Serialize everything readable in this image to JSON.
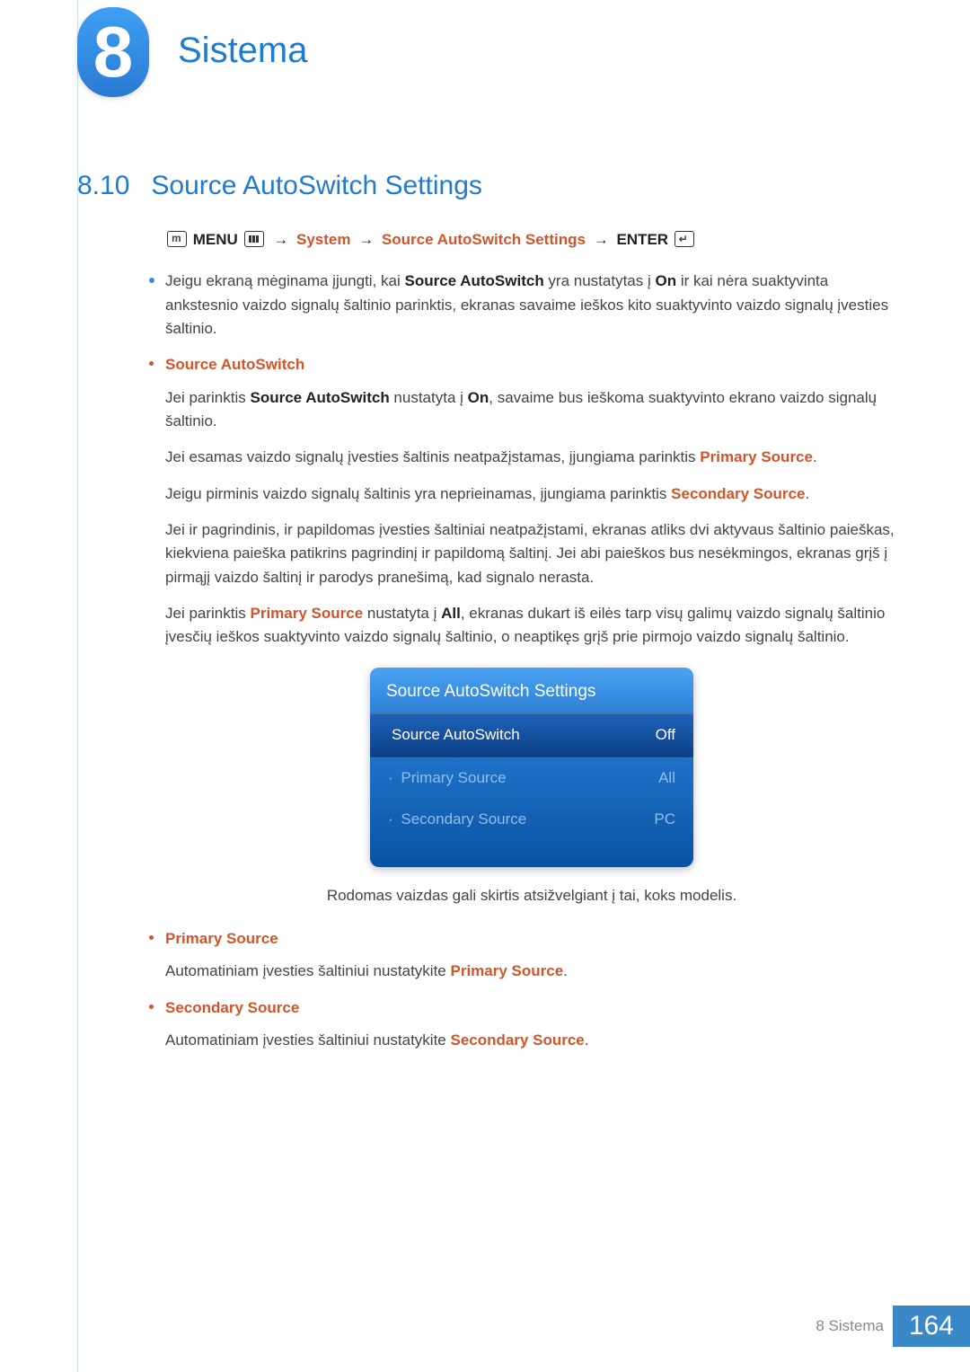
{
  "chapter": {
    "number": "8",
    "title": "Sistema"
  },
  "section": {
    "number": "8.10",
    "title": "Source AutoSwitch Settings"
  },
  "nav": {
    "menu": "MENU",
    "system": "System",
    "sas": "Source AutoSwitch Settings",
    "enter": "ENTER"
  },
  "intro": {
    "t1a": "Jeigu ekraną mėginama įjungti, kai ",
    "t1b": "Source AutoSwitch",
    "t1c": " yra nustatytas į ",
    "t1d": "On",
    "t1e": " ir kai nėra suaktyvinta ankstesnio vaizdo signalų šaltinio parinktis, ekranas savaime ieškos kito suaktyvinto vaizdo signalų įvesties šaltinio."
  },
  "sa": {
    "heading": "Source AutoSwitch",
    "p1a": "Jei parinktis ",
    "p1b": "Source AutoSwitch",
    "p1c": " nustatyta į ",
    "p1d": "On",
    "p1e": ", savaime bus ieškoma suaktyvinto ekrano vaizdo signalų šaltinio.",
    "p2a": "Jei esamas vaizdo signalų įvesties šaltinis neatpažįstamas, įjungiama parinktis ",
    "p2b": "Primary Source",
    "p2c": ".",
    "p3a": "Jeigu pirminis vaizdo signalų šaltinis yra neprieinamas, įjungiama parinktis ",
    "p3b": "Secondary Source",
    "p3c": ".",
    "p4": "Jei ir pagrindinis, ir papildomas įvesties šaltiniai neatpažįstami, ekranas atliks dvi aktyvaus šaltinio paieškas, kiekviena paieška patikrins pagrindinį ir papildomą šaltinį. Jei abi paieškos bus nesėkmingos, ekranas grįš į pirmąjį vaizdo šaltinį ir parodys pranešimą, kad signalo nerasta.",
    "p5a": "Jei parinktis ",
    "p5b": "Primary Source",
    "p5c": " nustatyta į ",
    "p5d": "All",
    "p5e": ", ekranas dukart iš eilės tarp visų galimų vaizdo signalų šaltinio įvesčių ieškos suaktyvinto vaizdo signalų šaltinio, o neaptikęs grįš prie pirmojo vaizdo signalų šaltinio."
  },
  "osd": {
    "title": "Source AutoSwitch Settings",
    "rows": [
      {
        "label": "Source AutoSwitch",
        "value": "Off",
        "selected": true,
        "prefix": ""
      },
      {
        "label": "Primary Source",
        "value": "All",
        "selected": false,
        "prefix": "· "
      },
      {
        "label": "Secondary Source",
        "value": "PC",
        "selected": false,
        "prefix": "· "
      }
    ],
    "caption": "Rodomas vaizdas gali skirtis atsižvelgiant į tai, koks modelis."
  },
  "ps": {
    "heading": "Primary Source",
    "p1a": "Automatiniam įvesties šaltiniui nustatykite ",
    "p1b": "Primary Source",
    "p1c": "."
  },
  "ss": {
    "heading": "Secondary Source",
    "p1a": "Automatiniam įvesties šaltiniui nustatykite ",
    "p1b": "Secondary Source",
    "p1c": "."
  },
  "footer": {
    "text": "8 Sistema",
    "page": "164"
  }
}
